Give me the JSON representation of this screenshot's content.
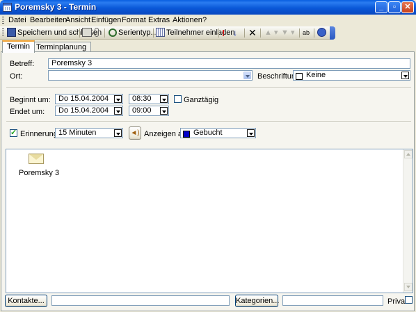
{
  "window": {
    "title": "Poremsky 3 - Termin",
    "min": "_",
    "max": "▫",
    "close": "✕"
  },
  "menu": [
    "Datei",
    "Bearbeiten",
    "Ansicht",
    "Einfügen",
    "Format",
    "Extras",
    "Aktionen",
    "?"
  ],
  "toolbar": {
    "save_close": "Speichern und schließen",
    "recurrence": "Serientyp...",
    "invite": "Teilnehmer einladen"
  },
  "tabs": [
    "Termin",
    "Terminplanung"
  ],
  "form": {
    "subject_label": "Betreff:",
    "subject_value": "Poremsky 3",
    "location_label": "Ort:",
    "location_value": "",
    "label_label": "Beschriftung:",
    "label_value": "Keine",
    "start_label": "Beginnt um:",
    "start_date": "Do 15.04.2004",
    "start_time": "08:30",
    "end_label": "Endet um:",
    "end_date": "Do 15.04.2004",
    "end_time": "09:00",
    "allday_label": "Ganztägig",
    "allday_checked": false,
    "reminder_label": "Erinnerung:",
    "reminder_checked": true,
    "reminder_value": "15 Minuten",
    "showas_label": "Anzeigen als:",
    "showas_value": "Gebucht",
    "showas_color": "#0000c8"
  },
  "notes": {
    "attachment_name": "Poremsky 3",
    "attachment_icon": "envelope-icon"
  },
  "footer": {
    "contacts_button": "Kontakte...",
    "contacts_value": "",
    "categories_button": "Kategorien...",
    "categories_value": "",
    "private_label": "Privat",
    "private_checked": false
  }
}
